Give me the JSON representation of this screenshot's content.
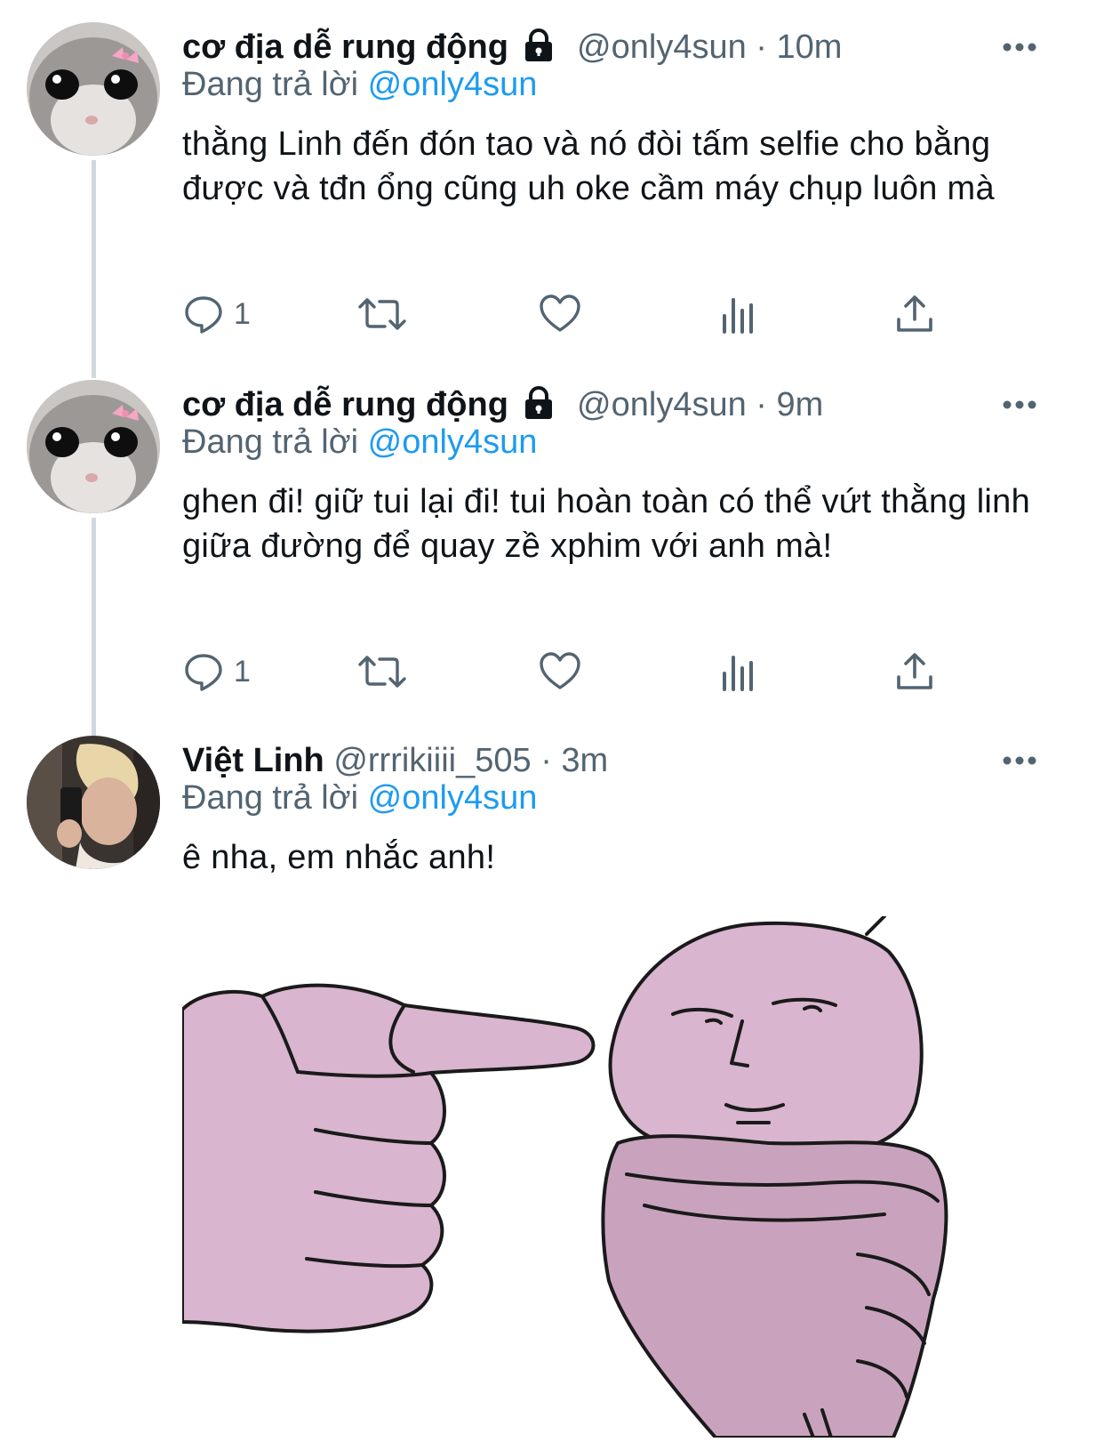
{
  "colors": {
    "text": "#0f1419",
    "secondary": "#536471",
    "link": "#1d9bf0",
    "thread_line": "#cfd9de"
  },
  "tweets": [
    {
      "name": "cơ địa dễ rung động",
      "handle": "@only4sun",
      "separator": "·",
      "time": "10m",
      "reply_prefix": "Đang trả lời",
      "reply_to": "@only4sun",
      "text": "thằng Linh đến đón tao và nó đòi tấm selfie cho bằng được và tđn ổng cũng uh oke cầm máy chụp luôn mà",
      "reply_count": "1",
      "icons": [
        "reply-icon",
        "retweet-icon",
        "like-icon",
        "analytics-icon",
        "share-icon"
      ]
    },
    {
      "name": "cơ địa dễ rung động",
      "handle": "@only4sun",
      "separator": "·",
      "time": "9m",
      "reply_prefix": "Đang trả lời",
      "reply_to": "@only4sun",
      "text": "ghen đi! giữ tui lại đi! tui hoàn toàn có thể vứt thằng linh giữa đường để quay zề xphim với anh mà!",
      "reply_count": "1",
      "icons": [
        "reply-icon",
        "retweet-icon",
        "like-icon",
        "analytics-icon",
        "share-icon"
      ]
    },
    {
      "name": "Việt Linh",
      "handle": "@rrrikiiii_505",
      "separator": "·",
      "time": "3m",
      "reply_prefix": "Đang trả lời",
      "reply_to": "@only4sun",
      "text": "ê nha, em nhắc anh!",
      "media": "pink-cartoon-pointing-meme"
    }
  ]
}
